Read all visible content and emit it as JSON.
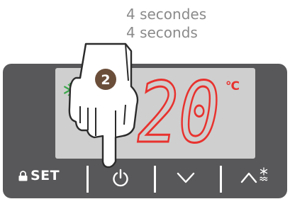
{
  "caption": {
    "line_fr": "4 secondes",
    "line_en": "4 seconds"
  },
  "display": {
    "temperature": "20",
    "unit": "°C"
  },
  "step_badge": "2",
  "buttons": {
    "set_label": "SET"
  },
  "colors": {
    "panel": "#58585a",
    "lcd": "#cfcfcf",
    "digit_red": "#e8322e",
    "snowflake_green": "#3aa84a",
    "badge_brown": "#6b4e3a"
  },
  "icons": [
    "lock-icon",
    "power-icon",
    "chevron-down-icon",
    "chevron-up-icon",
    "defrost-icon",
    "snowflake-icon",
    "pointing-hand-icon"
  ]
}
